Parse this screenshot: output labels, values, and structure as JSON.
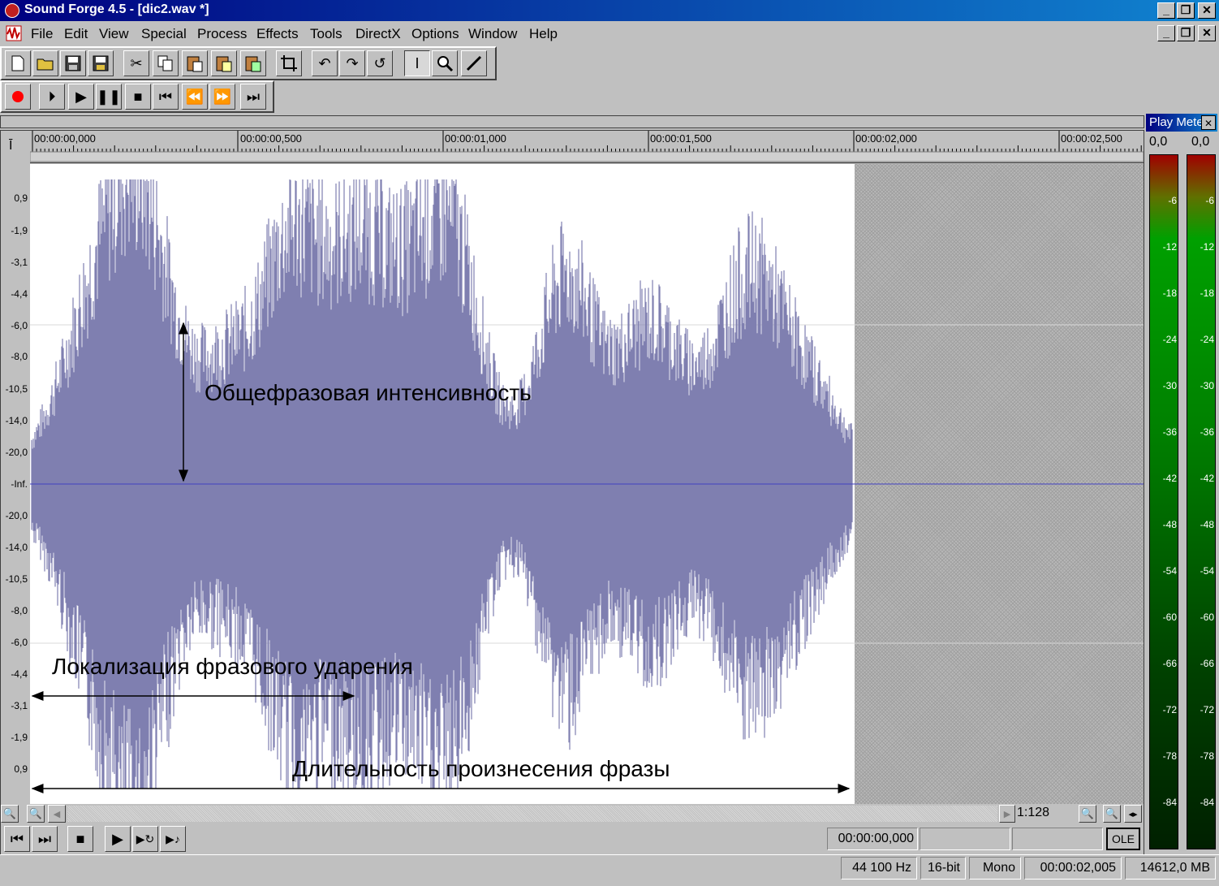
{
  "window": {
    "title": "Sound Forge 4.5 - [dic2.wav *]",
    "min_glyph": "_",
    "restore_glyph": "❐",
    "close_glyph": "✕"
  },
  "menu": [
    "File",
    "Edit",
    "View",
    "Special",
    "Process",
    "Effects",
    "Tools",
    "DirectX",
    "Options",
    "Window",
    "Help"
  ],
  "timeline": {
    "labels": [
      "00:00:00,000",
      "00:00:00,500",
      "00:00:01,000",
      "00:00:01,500",
      "00:00:02,000",
      "00:00:02,500"
    ]
  },
  "amplitude_labels": [
    "0,9",
    "-1,9",
    "-3,1",
    "-4,4",
    "-6,0",
    "-8,0",
    "-10,5",
    "-14,0",
    "-20,0",
    "-Inf.",
    "-20,0",
    "-14,0",
    "-10,5",
    "-8,0",
    "-6,0",
    "-4,4",
    "-3,1",
    "-1,9",
    "0,9"
  ],
  "annotations": {
    "intensity": "Общефразовая интенсивность",
    "stress": "Локализация фразового ударения",
    "duration": "Длительность произнесения фразы"
  },
  "play_meter": {
    "title": "Play Meter",
    "left_value": "0,0",
    "right_value": "0,0",
    "ticks": [
      "-6",
      "-12",
      "-18",
      "-24",
      "-30",
      "-36",
      "-42",
      "-48",
      "-54",
      "-60",
      "-66",
      "-72",
      "-78",
      "-84"
    ]
  },
  "zoom_ratio": "1:128",
  "transport_time": "00:00:00,000",
  "ole_label": "OLE",
  "status": {
    "sample_rate": "44 100 Hz",
    "bit_depth": "16-bit",
    "channels": "Mono",
    "length": "00:00:02,005",
    "free_space": "14612,0 MB"
  },
  "colors": {
    "waveform": "#7f7fb0",
    "title_start": "#000080",
    "title_end": "#1084d0",
    "record": "#ff0000"
  }
}
